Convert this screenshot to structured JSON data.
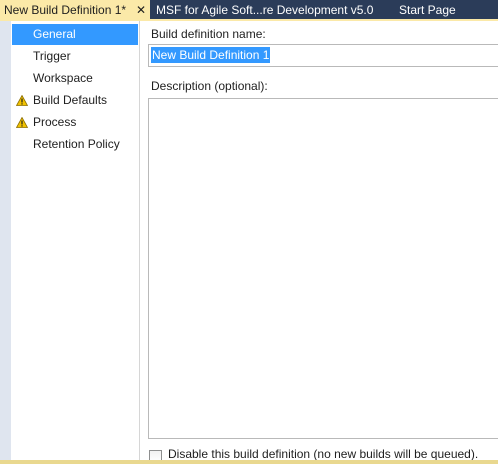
{
  "tabs": [
    {
      "label": "New Build Definition 1*",
      "active": true,
      "close": "✕"
    },
    {
      "label": "MSF for Agile Soft...re Development v5.0",
      "active": false
    },
    {
      "label": "Start Page",
      "active": false
    }
  ],
  "nav": {
    "items": [
      {
        "label": "General",
        "selected": true,
        "icon": null
      },
      {
        "label": "Trigger",
        "selected": false,
        "icon": null
      },
      {
        "label": "Workspace",
        "selected": false,
        "icon": null
      },
      {
        "label": "Build Defaults",
        "selected": false,
        "icon": "warning-icon"
      },
      {
        "label": "Process",
        "selected": false,
        "icon": "warning-icon"
      },
      {
        "label": "Retention Policy",
        "selected": false,
        "icon": null
      }
    ]
  },
  "general": {
    "name_label": "Build definition name:",
    "name_value": "New Build Definition 1",
    "description_label": "Description (optional):",
    "description_value": "",
    "disable_label": "Disable this build definition (no new builds will be queued).",
    "disable_checked": false
  },
  "colors": {
    "tab_strip": "#2b3c59",
    "active_tab": "#fbe9a8",
    "selection": "#3399ff",
    "warning": "#f2c200"
  }
}
